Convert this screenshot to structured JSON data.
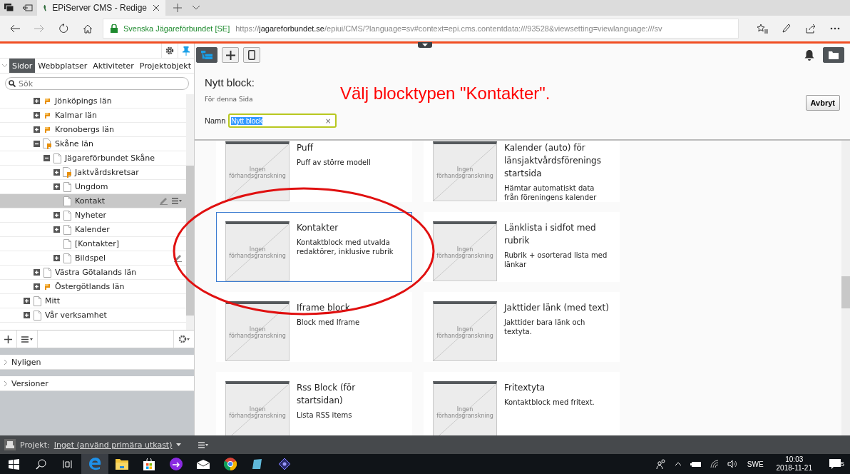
{
  "browser": {
    "tab_title": "EPiServer CMS - Redige",
    "site_name": "Svenska Jägareförbundet [SE]",
    "url_prefix": "https://",
    "url_host": "jagareforbundet.se",
    "url_path": "/epiui/CMS/?language=sv#context=epi.cms.contentdata:///93528&viewsetting=viewlanguage:///sv"
  },
  "left_tabs": [
    {
      "label": "Sidor",
      "selected": true
    },
    {
      "label": "Webbplatser",
      "selected": false
    },
    {
      "label": "Aktiviteter",
      "selected": false
    },
    {
      "label": "Projektobjekt",
      "selected": false
    }
  ],
  "search": {
    "placeholder": "Sök"
  },
  "tree": [
    {
      "children": [
        {
          "label": "Jönköpings län",
          "kind": "shortcut",
          "expanded": false,
          "selected": false,
          "edited": false
        },
        {
          "label": "Kalmar län",
          "kind": "shortcut",
          "expanded": false,
          "selected": false,
          "edited": false
        },
        {
          "label": "Kronobergs län",
          "kind": "shortcut",
          "expanded": false,
          "selected": false,
          "edited": false
        },
        {
          "label": "Skåne län",
          "kind": "page-shortcut",
          "expanded": true,
          "selected": false,
          "edited": false,
          "children": [
            {
              "label": "Jägareförbundet Skåne",
              "kind": "page",
              "expanded": true,
              "selected": false,
              "edited": false,
              "children": [
                {
                  "label": "Jaktvårdskretsar",
                  "kind": "page-shortcut",
                  "expanded": false,
                  "selected": false,
                  "edited": false
                },
                {
                  "label": "Ungdom",
                  "kind": "page",
                  "expanded": false,
                  "selected": false,
                  "edited": false
                },
                {
                  "label": "Kontakt",
                  "kind": "page",
                  "selected": true,
                  "edited": true
                },
                {
                  "label": "Nyheter",
                  "kind": "page",
                  "expanded": false,
                  "selected": false,
                  "edited": false
                },
                {
                  "label": "Kalender",
                  "kind": "page",
                  "expanded": false,
                  "selected": false,
                  "edited": false
                },
                {
                  "label": "[Kontakter]",
                  "kind": "page",
                  "selected": false,
                  "edited": false
                },
                {
                  "label": "Bildspel",
                  "kind": "page",
                  "expanded": false,
                  "selected": false,
                  "edited": true
                }
              ]
            }
          ]
        },
        {
          "label": "Västra Götalands län",
          "kind": "page",
          "expanded": false,
          "selected": false,
          "edited": false
        },
        {
          "label": "Östergötlands län",
          "kind": "shortcut",
          "expanded": false,
          "selected": false,
          "edited": false
        }
      ]
    },
    {
      "label": "Mitt",
      "kind": "page",
      "expanded": false,
      "selected": false,
      "edited": false
    },
    {
      "label": "Vår verksamhet",
      "kind": "page",
      "expanded": false,
      "selected": false,
      "edited": false
    }
  ],
  "panels": [
    {
      "label": "Nyligen",
      "expanded": false
    },
    {
      "label": "Versioner",
      "expanded": false
    }
  ],
  "dialog": {
    "title": "Nytt block:",
    "subtitle": "För denna Sida",
    "annotation": "Välj blocktypen \"Kontakter\".",
    "name_label": "Namn",
    "name_value": "Nytt block",
    "clear": "×",
    "cancel": "Avbryt"
  },
  "blocks": [
    {
      "title": "Puff",
      "description": "Puff av större modell",
      "preview": "Ingen förhandsgranskning",
      "selected": false
    },
    {
      "title": "Kalender (auto) för länsjaktvårdsförenings startsida",
      "description": "Hämtar automatiskt data från föreningens kalender",
      "preview": "Ingen förhandsgranskning",
      "selected": false
    },
    {
      "title": "Kontakter",
      "description": "Kontaktblock med utvalda redaktörer, inklusive rubrik",
      "preview": "Ingen förhandsgranskning",
      "selected": true
    },
    {
      "title": "Länklista i sidfot med rubrik",
      "description": "Rubrik + osorterad lista med länkar",
      "preview": "Ingen förhandsgranskning",
      "selected": false
    },
    {
      "title": "Iframe block",
      "description": "Block med Iframe",
      "preview": "Ingen förhandsgranskning",
      "selected": false
    },
    {
      "title": "Jakttider länk (med text)",
      "description": "Jakttider bara länk och textyta.",
      "preview": "Ingen förhandsgranskning",
      "selected": false
    },
    {
      "title": "Rss Block (för startsidan)",
      "description": "Lista RSS items",
      "preview": "Ingen förhandsgranskning",
      "selected": false
    },
    {
      "title": "Fritextyta",
      "description": "Kontaktblock med fritext.",
      "preview": "Ingen förhandsgranskning",
      "selected": false
    }
  ],
  "project_bar": {
    "label": "Projekt:",
    "value": "Inget (använd primära utkast)"
  },
  "taskbar": {
    "language": "SWE",
    "time": "10:03",
    "date": "2018-11-21",
    "notifications": "5"
  }
}
